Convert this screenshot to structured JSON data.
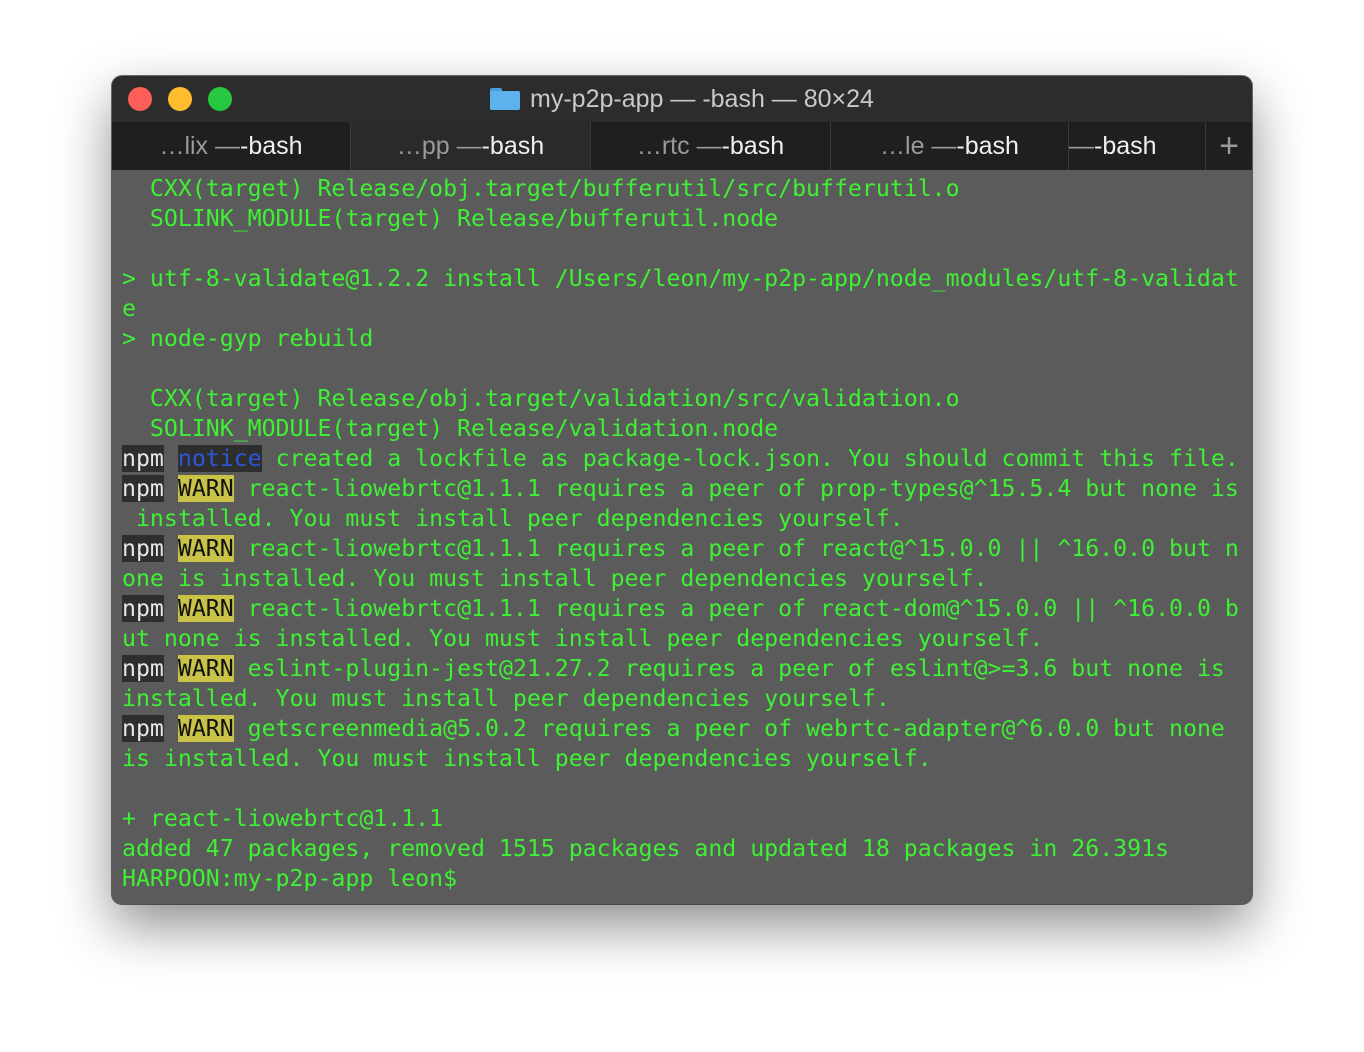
{
  "window": {
    "title": "my-p2p-app — -bash — 80×24",
    "folder_icon": "folder-icon"
  },
  "tabs": [
    {
      "dim": "…lix — ",
      "cmd": "-bash",
      "active": false
    },
    {
      "dim": "…pp — ",
      "cmd": "-bash",
      "active": true
    },
    {
      "dim": "…rtc — ",
      "cmd": "-bash",
      "active": false
    },
    {
      "dim": "…le — ",
      "cmd": "-bash",
      "active": false
    },
    {
      "dim": "— ",
      "cmd": "-bash",
      "active": false
    }
  ],
  "new_tab_label": "+",
  "colors": {
    "terminal_text": "#3ff035",
    "terminal_bg": "#5b5b5b",
    "warn_bg": "#c8c247",
    "notice_fg": "#2e56d8"
  },
  "terminal": {
    "lines": [
      [
        {
          "t": "  CXX(target) Release/obj.target/bufferutil/src/bufferutil.o"
        }
      ],
      [
        {
          "t": "  SOLINK_MODULE(target) Release/bufferutil.node"
        }
      ],
      [
        {
          "t": ""
        }
      ],
      [
        {
          "t": "> utf-8-validate@1.2.2 install /Users/leon/my-p2p-app/node_modules/utf-8-validat"
        }
      ],
      [
        {
          "t": "e"
        }
      ],
      [
        {
          "t": "> node-gyp rebuild"
        }
      ],
      [
        {
          "t": ""
        }
      ],
      [
        {
          "t": "  CXX(target) Release/obj.target/validation/src/validation.o"
        }
      ],
      [
        {
          "t": "  SOLINK_MODULE(target) Release/validation.node"
        }
      ],
      [
        {
          "t": "npm",
          "s": "npm"
        },
        {
          "t": " "
        },
        {
          "t": "notice",
          "s": "notice"
        },
        {
          "t": " created a lockfile as package-lock.json. You should commit this file."
        }
      ],
      [
        {
          "t": "npm",
          "s": "npm"
        },
        {
          "t": " "
        },
        {
          "t": "WARN",
          "s": "warn"
        },
        {
          "t": " react-liowebrtc@1.1.1 requires a peer of prop-types@^15.5.4 but none is"
        }
      ],
      [
        {
          "t": " installed. You must install peer dependencies yourself."
        }
      ],
      [
        {
          "t": "npm",
          "s": "npm"
        },
        {
          "t": " "
        },
        {
          "t": "WARN",
          "s": "warn"
        },
        {
          "t": " react-liowebrtc@1.1.1 requires a peer of react@^15.0.0 || ^16.0.0 but n"
        }
      ],
      [
        {
          "t": "one is installed. You must install peer dependencies yourself."
        }
      ],
      [
        {
          "t": "npm",
          "s": "npm"
        },
        {
          "t": " "
        },
        {
          "t": "WARN",
          "s": "warn"
        },
        {
          "t": " react-liowebrtc@1.1.1 requires a peer of react-dom@^15.0.0 || ^16.0.0 b"
        }
      ],
      [
        {
          "t": "ut none is installed. You must install peer dependencies yourself."
        }
      ],
      [
        {
          "t": "npm",
          "s": "npm"
        },
        {
          "t": " "
        },
        {
          "t": "WARN",
          "s": "warn"
        },
        {
          "t": " eslint-plugin-jest@21.27.2 requires a peer of eslint@>=3.6 but none is"
        }
      ],
      [
        {
          "t": "installed. You must install peer dependencies yourself."
        }
      ],
      [
        {
          "t": "npm",
          "s": "npm"
        },
        {
          "t": " "
        },
        {
          "t": "WARN",
          "s": "warn"
        },
        {
          "t": " getscreenmedia@5.0.2 requires a peer of webrtc-adapter@^6.0.0 but none"
        }
      ],
      [
        {
          "t": "is installed. You must install peer dependencies yourself."
        }
      ],
      [
        {
          "t": ""
        }
      ],
      [
        {
          "t": "+ react-liowebrtc@1.1.1"
        }
      ],
      [
        {
          "t": "added 47 packages, removed 1515 packages and updated 18 packages in 26.391s"
        }
      ],
      [
        {
          "t": "HARPOON:my-p2p-app leon$ "
        }
      ]
    ]
  }
}
